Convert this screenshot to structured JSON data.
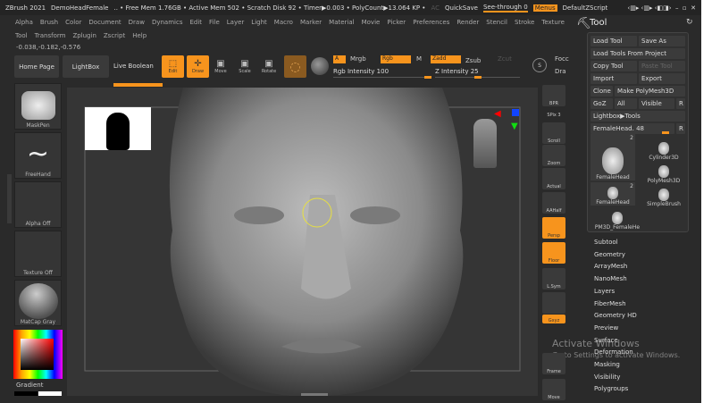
{
  "title_bar": {
    "app": "ZBrush 2021",
    "project": "DemoHeadFemale",
    "stats": ".. • Free Mem 1.76GB • Active Mem 502 • Scratch Disk 92 • Timer▶0.003 • PolyCount▶13.064 KP •",
    "ac": "AC",
    "quicksave": "QuickSave",
    "see_through": "See-through  0",
    "menus": "Menus",
    "default_zscript": "DefaultZScript"
  },
  "menu_row1": [
    "Alpha",
    "Brush",
    "Color",
    "Document",
    "Draw",
    "Dynamics",
    "Edit",
    "File",
    "Layer",
    "Light",
    "Macro",
    "Marker",
    "Material",
    "Movie",
    "Picker",
    "Preferences",
    "Render",
    "Stencil",
    "Stroke",
    "Texture"
  ],
  "menu_row2": [
    "Tool",
    "Transform",
    "Zplugin",
    "Zscript",
    "Help"
  ],
  "coords": "-0.038,-0.182,-0.576",
  "toolbar": {
    "home_page": "Home Page",
    "lightbox": "LightBox",
    "live_boolean": "Live Boolean",
    "edit": "Edit",
    "draw": "Draw",
    "move": "Move",
    "scale": "Scale",
    "rotate": "Rotate",
    "a": "A",
    "mrgb": "Mrgb",
    "rgb": "Rgb",
    "m": "M",
    "zadd": "Zadd",
    "zsub": "Zsub",
    "zcut": "Zcut",
    "rgb_intensity": "Rgb Intensity 100",
    "z_intensity": "Z Intensity 25",
    "focal": "Focc",
    "draw_size": "Dra",
    "s": "S"
  },
  "sliders": {
    "rgb_intensity": 100,
    "z_intensity": 25
  },
  "left_panel": {
    "brush": "MaskPen",
    "stroke": "FreeHand",
    "alpha": "Alpha Off",
    "texture": "Texture Off",
    "material": "MatCap Gray",
    "gradient": "Gradient"
  },
  "right_shelf": [
    "BPR",
    "SPix 3",
    "Scroll",
    "Zoom",
    "Actual",
    "AAHalf",
    "Persp",
    "Floor",
    "L.Sym",
    "",
    "Gxyz",
    "Frame",
    "Move"
  ],
  "tool_panel": {
    "title": "Tool",
    "load_tool": "Load Tool",
    "save_as": "Save As",
    "load_from_project": "Load Tools From Project",
    "copy_tool": "Copy Tool",
    "paste_tool": "Paste Tool",
    "import": "Import",
    "export": "Export",
    "clone": "Clone",
    "make_polymesh": "Make PolyMesh3D",
    "goz": "GoZ",
    "all": "All",
    "visible": "Visible",
    "r": "R",
    "lightbox_tools": "Lightbox▶Tools",
    "current": "FemaleHead. 48",
    "current_r": "R",
    "tools": [
      {
        "name": "FemaleHead",
        "count": "2"
      },
      {
        "name": "Cylinder3D"
      },
      {
        "name": "PolyMesh3D"
      },
      {
        "name": "FemaleHead",
        "count": "2"
      },
      {
        "name": "SimpleBrush"
      },
      {
        "name": "PM3D_FemaleHe"
      }
    ]
  },
  "subpalettes": [
    "Subtool",
    "Geometry",
    "ArrayMesh",
    "NanoMesh",
    "Layers",
    "FiberMesh",
    "Geometry HD",
    "Preview",
    "Surface",
    "Deformation",
    "Masking",
    "Visibility",
    "Polygroups"
  ],
  "watermark": {
    "line1": "Activate Windows",
    "line2": "Go to Settings to activate Windows."
  },
  "colors": {
    "accent": "#f7941d",
    "bg": "#2a2a2a"
  }
}
